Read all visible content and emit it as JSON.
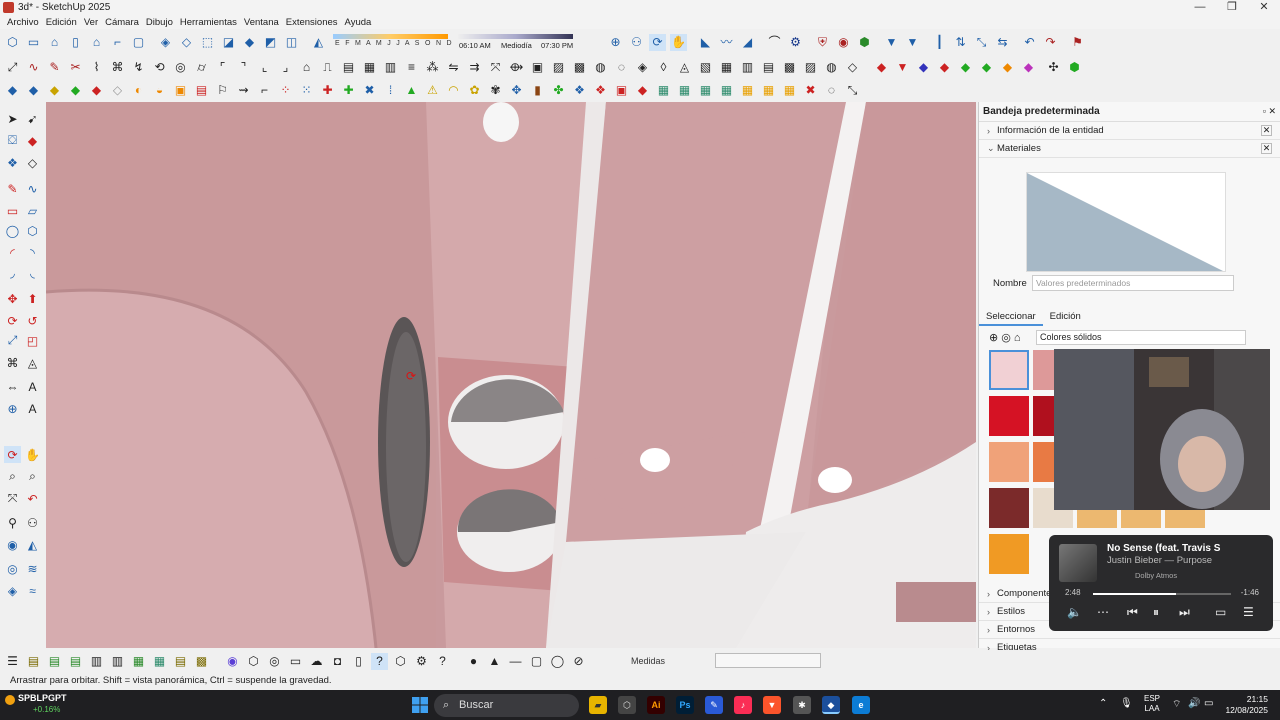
{
  "window": {
    "title": "3d* - SketchUp 2025",
    "controls": [
      "—",
      "❐",
      "✕"
    ]
  },
  "menu": [
    "Archivo",
    "Edición",
    "Ver",
    "Cámara",
    "Dibujo",
    "Herramientas",
    "Ventana",
    "Extensiones",
    "Ayuda"
  ],
  "shadows": {
    "months": "E F M A M J J A S O N D",
    "time_start": "06:10 AM",
    "time_mid": "Mediodía",
    "time_end": "07:30 PM"
  },
  "tray": {
    "title": "Bandeja predeterminada",
    "entity_info": "Información de la entidad",
    "materials": "Materiales",
    "name_label": "Nombre",
    "name_placeholder": "Valores predeterminados",
    "tab_select": "Seleccionar",
    "tab_edit": "Edición",
    "library": "Colores sólidos",
    "sections": [
      "Componentes",
      "Estilos",
      "Entornos",
      "Etiquetas"
    ]
  },
  "music": {
    "song": "No Sense (feat. Travis S",
    "artist": "Justin Bieber — Purpose",
    "badge": "Dolby Atmos",
    "elapsed": "2:48",
    "remaining": "-1:46",
    "progress": 0.6
  },
  "bottom": {
    "measure_label": "Medidas",
    "measure_value": ""
  },
  "status": "Arrastrar para orbitar. Shift = vista panorámica, Ctrl = suspende la gravedad.",
  "taskbar": {
    "ticker": "SPBLPGPT",
    "ticker_change": "+0.16%",
    "search": "Buscar",
    "lang_top": "ESP",
    "lang_bottom": "LAA",
    "time": "21:15",
    "date": "12/08/2025"
  },
  "colors": {
    "wall": "#c89a9c",
    "accent": "#4a90d9",
    "taskbar": "#1f1f22"
  }
}
